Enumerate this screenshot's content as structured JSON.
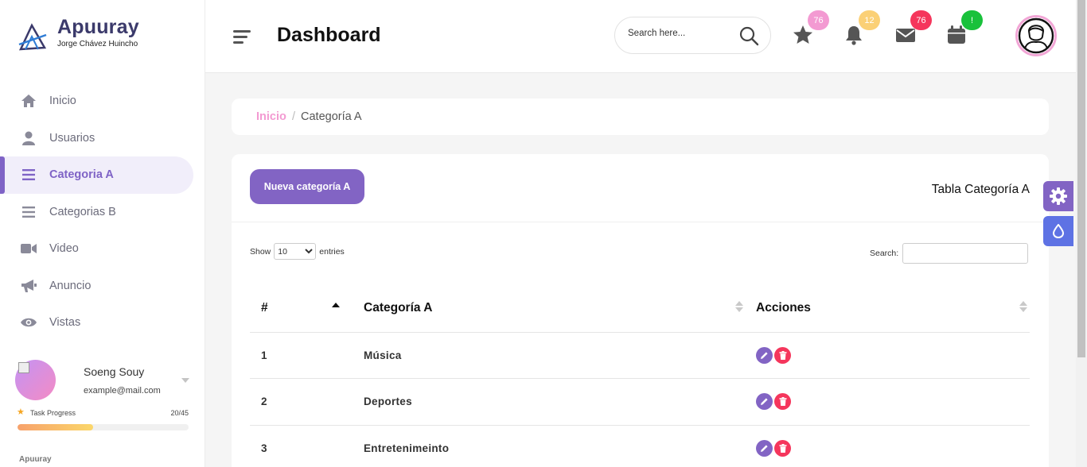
{
  "brand": {
    "name": "Apuuray",
    "subtitle": "Jorge Chávez Huincho"
  },
  "sidebar": {
    "items": [
      {
        "label": "Inicio",
        "icon": "home-icon"
      },
      {
        "label": "Usuarios",
        "icon": "user-icon"
      },
      {
        "label": "Categoria A",
        "icon": "list-icon",
        "active": true
      },
      {
        "label": "Categorias B",
        "icon": "list-icon"
      },
      {
        "label": "Video",
        "icon": "video-icon"
      },
      {
        "label": "Anuncio",
        "icon": "megaphone-icon"
      },
      {
        "label": "Vistas",
        "icon": "eye-icon"
      }
    ],
    "profile": {
      "name": "Soeng Souy",
      "email": "example@mail.com"
    },
    "task": {
      "label": "Task Progress",
      "count": "20/45",
      "progress": 0.444
    },
    "footer": "Apuuray"
  },
  "header": {
    "title": "Dashboard",
    "search_placeholder": "Search here...",
    "badges": {
      "favorites": "76",
      "notifications": "12",
      "messages": "76",
      "calendar": "!"
    }
  },
  "breadcrumb": {
    "home": "Inicio",
    "separator": "/",
    "current": "Categoría A"
  },
  "card": {
    "new_button": "Nueva categoría A",
    "title": "Tabla Categoría A",
    "show_label": "Show",
    "entries_label": "entries",
    "page_size": "10",
    "search_label": "Search:"
  },
  "table": {
    "headers": [
      "#",
      "Categoría A",
      "Acciones"
    ],
    "rows": [
      {
        "id": "1",
        "name": "Música"
      },
      {
        "id": "2",
        "name": "Deportes"
      },
      {
        "id": "3",
        "name": "Entretenimeinto"
      }
    ]
  },
  "colors": {
    "accent": "#8264c4",
    "danger": "#f5365c",
    "breadcrumb_home": "#f39ad2",
    "badge_favorites": "#f39ad2",
    "badge_notifications": "#fbd076",
    "badge_messages": "#f5365c",
    "badge_calendar": "#19c13b"
  }
}
